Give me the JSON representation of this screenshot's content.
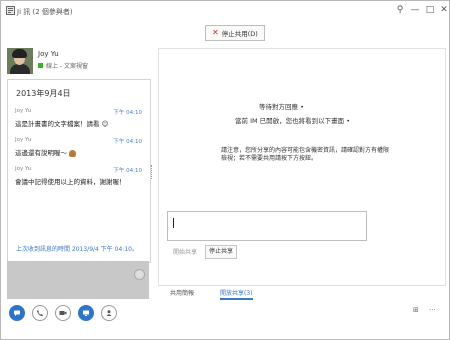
{
  "window": {
    "title": "Ji 訊 (2 個參與者)",
    "controls": [
      "⚲",
      "—",
      "□",
      "✕"
    ]
  },
  "stop_sharing_label": "停止共用(D)",
  "contact": {
    "name": "Joy Yu",
    "status": "線上 - 文案視窗"
  },
  "conversation": {
    "date": "2013年9月4日",
    "messages": [
      {
        "sender": "Joy Yu",
        "time": "下午 04:10",
        "text": "這是計畫書的文字檔案！請看 ☺"
      },
      {
        "sender": "Joy Yu",
        "time": "下午 04:10",
        "text": "這邊還有說明喔～"
      },
      {
        "sender": "Joy Yu",
        "time": "下午 04:10",
        "text": "會議中記得使用以上的資料，謝謝喔！"
      }
    ],
    "last_message": "上次收到訊息的時間 2013/9/4 下午 04:10。"
  },
  "sharing": {
    "waiting": "等待對方回應 •",
    "invite": "當前 IM 已開啟，您也將看到以下畫面 •",
    "note": "請注意，您所分享的內容可能包含機密資訊，請確認對方有權限檢視；若不需要共用請按下方按鈕。",
    "request_label": "開始共享",
    "stop_share_button": "停止共享"
  },
  "tabs": [
    "共用簡報",
    "開放共享(3)"
  ],
  "toolbar": {
    "buttons": [
      "im-icon",
      "phone-icon",
      "video-icon",
      "share-icon",
      "participants-icon"
    ],
    "right": [
      "⊞",
      "···"
    ]
  },
  "colors": {
    "accent": "#2f74c8",
    "status_green": "#3fae29",
    "stop_red": "#d92b1e"
  }
}
